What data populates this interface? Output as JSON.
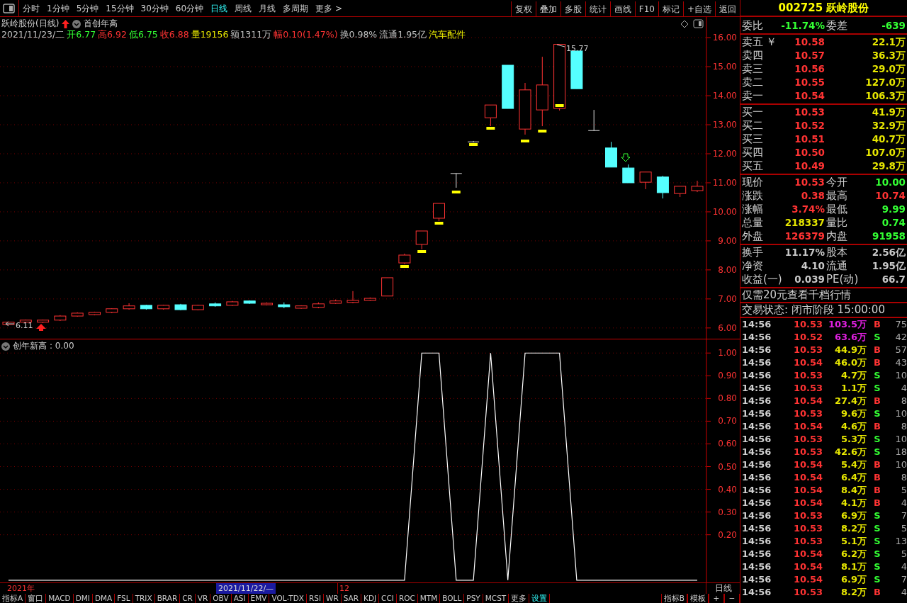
{
  "toolbar": {
    "periods": [
      {
        "label": "分时",
        "selected": false
      },
      {
        "label": "1分钟",
        "selected": false
      },
      {
        "label": "5分钟",
        "selected": false
      },
      {
        "label": "15分钟",
        "selected": false
      },
      {
        "label": "30分钟",
        "selected": false
      },
      {
        "label": "60分钟",
        "selected": false
      },
      {
        "label": "日线",
        "selected": true
      },
      {
        "label": "周线",
        "selected": false
      },
      {
        "label": "月线",
        "selected": false
      },
      {
        "label": "多周期",
        "selected": false
      },
      {
        "label": "更多 >",
        "selected": false
      }
    ],
    "buttons": [
      "复权",
      "叠加",
      "多股",
      "统计",
      "画线",
      "F10",
      "标记",
      "+自选",
      "返回"
    ]
  },
  "chart": {
    "title": "跃岭股份(日线)",
    "formula": "首创年高",
    "info": [
      {
        "text": "2021/11/23/二",
        "color": "#c0c0c0"
      },
      {
        "text": "开6.77",
        "color": "#33ff33"
      },
      {
        "text": "高6.92",
        "color": "#ff3333"
      },
      {
        "text": "低6.75",
        "color": "#33ff33"
      },
      {
        "text": "收6.88",
        "color": "#ff3333"
      },
      {
        "text": "量19156",
        "color": "#e6e600"
      },
      {
        "text": "额1311万",
        "color": "#c0c0c0"
      },
      {
        "text": "幅0.10(1.47%)",
        "color": "#ff3333"
      },
      {
        "text": "换0.98%",
        "color": "#c0c0c0"
      },
      {
        "text": "流通1.95亿",
        "color": "#c0c0c0"
      },
      {
        "text": "汽车配件",
        "color": "#e6e600"
      }
    ],
    "high_label": "15.77",
    "low_label": "6.11",
    "chart_data": {
      "type": "candlestick",
      "grid": true,
      "ylim": [
        5.63,
        16.71
      ],
      "yticks": [
        {
          "value": 16,
          "label": "16.00"
        },
        {
          "value": 15,
          "label": "15.00"
        },
        {
          "value": 14,
          "label": "14.00"
        },
        {
          "value": 13,
          "label": "13.00"
        },
        {
          "value": 12,
          "label": "12.00"
        },
        {
          "value": 11,
          "label": "11.00"
        },
        {
          "value": 10,
          "label": "10.00"
        },
        {
          "value": 9,
          "label": "9.00"
        },
        {
          "value": 8,
          "label": "8.00"
        },
        {
          "value": 7,
          "label": "7.00"
        },
        {
          "value": 6,
          "label": "6.00"
        }
      ],
      "ohlc": [
        [
          6.12,
          6.22,
          6.11,
          6.2
        ],
        [
          6.2,
          6.29,
          6.17,
          6.27
        ],
        [
          6.2,
          6.29,
          6.17,
          6.27
        ],
        [
          6.27,
          6.44,
          6.24,
          6.41
        ],
        [
          6.41,
          6.54,
          6.39,
          6.51
        ],
        [
          6.46,
          6.56,
          6.44,
          6.54
        ],
        [
          6.54,
          6.68,
          6.51,
          6.66
        ],
        [
          6.66,
          6.85,
          6.63,
          6.76
        ],
        [
          6.78,
          6.8,
          6.63,
          6.66
        ],
        [
          6.66,
          6.8,
          6.63,
          6.78
        ],
        [
          6.8,
          6.83,
          6.61,
          6.63
        ],
        [
          6.63,
          6.8,
          6.61,
          6.78
        ],
        [
          6.83,
          6.88,
          6.73,
          6.76
        ],
        [
          6.78,
          6.93,
          6.76,
          6.9
        ],
        [
          6.93,
          6.95,
          6.83,
          6.85
        ],
        [
          6.8,
          6.88,
          6.78,
          6.85
        ],
        [
          6.8,
          6.88,
          6.68,
          6.73
        ],
        [
          6.68,
          6.78,
          6.66,
          6.76
        ],
        [
          6.71,
          6.88,
          6.68,
          6.83
        ],
        [
          6.85,
          6.98,
          6.83,
          6.93
        ],
        [
          6.88,
          7.27,
          6.85,
          6.95
        ],
        [
          6.95,
          7.05,
          6.93,
          7.02
        ],
        [
          7.1,
          7.73,
          7.1,
          7.73
        ],
        [
          8.24,
          8.56,
          8.2,
          8.51
        ],
        [
          8.88,
          9.34,
          8.71,
          9.34
        ],
        [
          9.78,
          10.29,
          9.68,
          10.29
        ],
        [
          11.32,
          11.32,
          10.83,
          11.32
        ],
        [
          12.41,
          12.44,
          12.39,
          12.41
        ],
        [
          13.24,
          13.68,
          12.95,
          13.68
        ],
        [
          15.05,
          15.05,
          13.56,
          13.56
        ],
        [
          12.85,
          14.44,
          12.66,
          14.2
        ],
        [
          13.51,
          15.34,
          12.95,
          14.37
        ],
        [
          13.56,
          15.77,
          13.49,
          15.77
        ],
        [
          15.54,
          15.54,
          14.24,
          14.24
        ],
        [
          12.8,
          13.51,
          12.8,
          12.8
        ],
        [
          12.2,
          12.41,
          11.54,
          11.54
        ],
        [
          11.51,
          11.63,
          11.0,
          11.0
        ],
        [
          11.02,
          11.37,
          10.78,
          11.37
        ],
        [
          11.2,
          11.24,
          10.46,
          10.66
        ],
        [
          10.63,
          10.88,
          10.51,
          10.88
        ],
        [
          10.73,
          11.07,
          10.68,
          10.88
        ]
      ]
    }
  },
  "indicator": {
    "value": ": 0.00",
    "chart_data": {
      "type": "line",
      "grid": true,
      "ylim": [
        -0.01,
        1.06
      ],
      "yticks": [
        {
          "value": 1,
          "label": "1.00"
        },
        {
          "value": 0.9,
          "label": "0.90"
        },
        {
          "value": 0.8,
          "label": "0.80"
        },
        {
          "value": 0.7,
          "label": "0.70"
        },
        {
          "value": 0.6,
          "label": "0.60"
        },
        {
          "value": 0.5,
          "label": "0.50"
        },
        {
          "value": 0.4,
          "label": "0.40"
        },
        {
          "value": 0.3,
          "label": "0.30"
        },
        {
          "value": 0.2,
          "label": "0.20"
        }
      ],
      "series": [
        {
          "name": "创年新高",
          "color": "#ffffff",
          "values": [
            0,
            0,
            0,
            0,
            0,
            0,
            0,
            0,
            0,
            0,
            0,
            0,
            0,
            0,
            0,
            0,
            0,
            0,
            0,
            0,
            0,
            0,
            0,
            0,
            1,
            1,
            0,
            0,
            1,
            0,
            1,
            1,
            1,
            0,
            0,
            0,
            0,
            0,
            0,
            0,
            0
          ]
        }
      ]
    }
  },
  "date_bar": {
    "year": "2021年",
    "cursor_date": "2021/11/22/—",
    "month": "12",
    "period": "日线"
  },
  "indicator_tabs": [
    {
      "label": "指标A",
      "accent": false
    },
    {
      "label": "窗口",
      "accent": false
    },
    {
      "label": "MACD",
      "accent": false
    },
    {
      "label": "DMI",
      "accent": false
    },
    {
      "label": "DMA",
      "accent": false
    },
    {
      "label": "FSL",
      "accent": false
    },
    {
      "label": "TRIX",
      "accent": false
    },
    {
      "label": "BRAR",
      "accent": false
    },
    {
      "label": "CR",
      "accent": false
    },
    {
      "label": "VR",
      "accent": false
    },
    {
      "label": "OBV",
      "accent": false
    },
    {
      "label": "ASI",
      "accent": false
    },
    {
      "label": "EMV",
      "accent": false
    },
    {
      "label": "VOL-TDX",
      "accent": false
    },
    {
      "label": "RSI",
      "accent": false
    },
    {
      "label": "WR",
      "accent": false
    },
    {
      "label": "SAR",
      "accent": false
    },
    {
      "label": "KDJ",
      "accent": false
    },
    {
      "label": "CCI",
      "accent": false
    },
    {
      "label": "ROC",
      "accent": false
    },
    {
      "label": "MTM",
      "accent": false
    },
    {
      "label": "BOLL",
      "accent": false
    },
    {
      "label": "PSY",
      "accent": false
    },
    {
      "label": "MCST",
      "accent": false
    },
    {
      "label": "更多",
      "accent": false
    },
    {
      "label": "设置",
      "accent": true
    }
  ],
  "right_tabs": [
    "指标B",
    "模板",
    "+",
    "−"
  ],
  "quote": {
    "code": "002725",
    "name": "跃岭股份",
    "ratio": [
      [
        {
          "label": "委比",
          "value": "-11.74%",
          "color": "#33ff33"
        },
        {
          "label": "委差",
          "value": "-639",
          "color": "#33ff33"
        }
      ]
    ],
    "asks": [
      {
        "label": "卖五",
        "marker": "￥",
        "price": "10.58",
        "volume": "22.1万"
      },
      {
        "label": "卖四",
        "price": "10.57",
        "volume": "36.3万"
      },
      {
        "label": "卖三",
        "price": "10.56",
        "volume": "29.0万"
      },
      {
        "label": "卖二",
        "price": "10.55",
        "volume": "127.0万"
      },
      {
        "label": "卖一",
        "price": "10.54",
        "volume": "106.3万"
      }
    ],
    "bids": [
      {
        "label": "买一",
        "price": "10.53",
        "volume": "41.9万"
      },
      {
        "label": "买二",
        "price": "10.52",
        "volume": "32.9万"
      },
      {
        "label": "买三",
        "price": "10.51",
        "volume": "40.7万"
      },
      {
        "label": "买四",
        "price": "10.50",
        "volume": "107.0万"
      },
      {
        "label": "买五",
        "price": "10.49",
        "volume": "29.8万"
      }
    ],
    "stats": [
      [
        {
          "label": "现价",
          "value": "10.53",
          "color": "#ff3333"
        },
        {
          "label": "今开",
          "value": "10.00",
          "color": "#33ff33"
        }
      ],
      [
        {
          "label": "涨跌",
          "value": "0.38",
          "color": "#ff3333"
        },
        {
          "label": "最高",
          "value": "10.74",
          "color": "#ff3333"
        }
      ],
      [
        {
          "label": "涨幅",
          "value": "3.74%",
          "color": "#ff3333"
        },
        {
          "label": "最低",
          "value": "9.99",
          "color": "#33ff33"
        }
      ],
      [
        {
          "label": "总量",
          "value": "218337",
          "color": "#e6e600"
        },
        {
          "label": "量比",
          "value": "0.74",
          "color": "#33ff33"
        }
      ],
      [
        {
          "label": "外盘",
          "value": "126379",
          "color": "#ff3333"
        },
        {
          "label": "内盘",
          "value": "91958",
          "color": "#33ff33"
        }
      ]
    ],
    "capital": [
      [
        {
          "label": "换手",
          "value": "11.17%"
        },
        {
          "label": "股本",
          "value": "2.56亿"
        }
      ],
      [
        {
          "label": "净资",
          "value": "4.10"
        },
        {
          "label": "流通",
          "value": "1.95亿"
        }
      ],
      [
        {
          "label": "收益(一)",
          "value": "0.039"
        },
        {
          "label": "PE(动)",
          "value": "66.7"
        }
      ]
    ],
    "promo": "仅需20元查看千档行情",
    "status": "交易状态: 闭市阶段 15:00:00",
    "ticks": [
      {
        "time": "14:56",
        "price": "10.53",
        "volume": "103.5万",
        "color": "#e020e0",
        "side": {
          "text": "B",
          "color": "#ff3333"
        },
        "count": "75"
      },
      {
        "time": "14:56",
        "price": "10.52",
        "volume": "63.6万",
        "color": "#e020e0",
        "side": {
          "text": "S",
          "color": "#33ff33"
        },
        "count": "42"
      },
      {
        "time": "14:56",
        "price": "10.53",
        "volume": "44.9万",
        "color": "#e6e600",
        "side": {
          "text": "B",
          "color": "#ff3333"
        },
        "count": "57"
      },
      {
        "time": "14:56",
        "price": "10.54",
        "volume": "46.0万",
        "color": "#e6e600",
        "side": {
          "text": "B",
          "color": "#ff3333"
        },
        "count": "43"
      },
      {
        "time": "14:56",
        "price": "10.53",
        "volume": "4.7万",
        "color": "#e6e600",
        "side": {
          "text": "S",
          "color": "#33ff33"
        },
        "count": "10"
      },
      {
        "time": "14:56",
        "price": "10.53",
        "volume": "1.1万",
        "color": "#e6e600",
        "side": {
          "text": "S",
          "color": "#33ff33"
        },
        "count": "4"
      },
      {
        "time": "14:56",
        "price": "10.54",
        "volume": "27.4万",
        "color": "#e6e600",
        "side": {
          "text": "B",
          "color": "#ff3333"
        },
        "count": "8"
      },
      {
        "time": "14:56",
        "price": "10.53",
        "volume": "9.6万",
        "color": "#e6e600",
        "side": {
          "text": "S",
          "color": "#33ff33"
        },
        "count": "10"
      },
      {
        "time": "14:56",
        "price": "10.54",
        "volume": "4.6万",
        "color": "#e6e600",
        "side": {
          "text": "B",
          "color": "#ff3333"
        },
        "count": "8"
      },
      {
        "time": "14:56",
        "price": "10.53",
        "volume": "5.3万",
        "color": "#e6e600",
        "side": {
          "text": "S",
          "color": "#33ff33"
        },
        "count": "10"
      },
      {
        "time": "14:56",
        "price": "10.53",
        "volume": "42.6万",
        "color": "#e6e600",
        "side": {
          "text": "S",
          "color": "#33ff33"
        },
        "count": "18"
      },
      {
        "time": "14:56",
        "price": "10.54",
        "volume": "5.4万",
        "color": "#e6e600",
        "side": {
          "text": "B",
          "color": "#ff3333"
        },
        "count": "10"
      },
      {
        "time": "14:56",
        "price": "10.54",
        "volume": "6.4万",
        "color": "#e6e600",
        "side": {
          "text": "B",
          "color": "#ff3333"
        },
        "count": "8"
      },
      {
        "time": "14:56",
        "price": "10.54",
        "volume": "8.4万",
        "color": "#e6e600",
        "side": {
          "text": "B",
          "color": "#ff3333"
        },
        "count": "5"
      },
      {
        "time": "14:56",
        "price": "10.54",
        "volume": "4.1万",
        "color": "#e6e600",
        "side": {
          "text": "B",
          "color": "#ff3333"
        },
        "count": "4"
      },
      {
        "time": "14:56",
        "price": "10.53",
        "volume": "6.9万",
        "color": "#e6e600",
        "side": {
          "text": "S",
          "color": "#33ff33"
        },
        "count": "7"
      },
      {
        "time": "14:56",
        "price": "10.53",
        "volume": "8.2万",
        "color": "#e6e600",
        "side": {
          "text": "S",
          "color": "#33ff33"
        },
        "count": "5"
      },
      {
        "time": "14:56",
        "price": "10.53",
        "volume": "5.1万",
        "color": "#e6e600",
        "side": {
          "text": "S",
          "color": "#33ff33"
        },
        "count": "13"
      },
      {
        "time": "14:56",
        "price": "10.54",
        "volume": "6.2万",
        "color": "#e6e600",
        "side": {
          "text": "S",
          "color": "#33ff33"
        },
        "count": "5"
      },
      {
        "time": "14:56",
        "price": "10.54",
        "volume": "8.1万",
        "color": "#e6e600",
        "side": {
          "text": "S",
          "color": "#33ff33"
        },
        "count": "4"
      },
      {
        "time": "14:56",
        "price": "10.54",
        "volume": "6.9万",
        "color": "#e6e600",
        "side": {
          "text": "S",
          "color": "#33ff33"
        },
        "count": "7"
      },
      {
        "time": "14:56",
        "price": "10.53",
        "volume": "8.2万",
        "color": "#e6e600",
        "side": {
          "text": "B",
          "color": "#ff3333"
        },
        "count": "4"
      }
    ]
  }
}
